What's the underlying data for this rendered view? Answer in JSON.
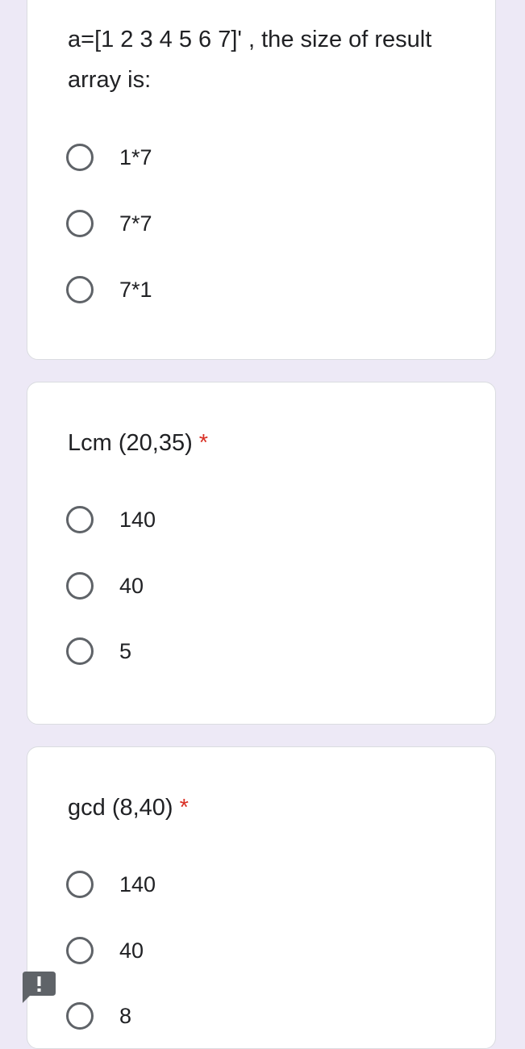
{
  "questions": [
    {
      "title": "a=[1 2 3 4 5 6 7]' , the size of result array is:",
      "required_mark": "",
      "options": [
        "1*7",
        "7*7",
        "7*1"
      ]
    },
    {
      "title": "Lcm (20,35)",
      "required_mark": "*",
      "options": [
        "140",
        "40",
        "5"
      ]
    },
    {
      "title": "gcd (8,40)",
      "required_mark": "*",
      "options": [
        "140",
        "40",
        "8"
      ]
    }
  ],
  "feedback_button": {
    "icon": "exclamation-feedback-icon"
  },
  "colors": {
    "page_background": "#ede9f6",
    "card_background": "#ffffff",
    "card_border": "#dadce0",
    "text": "#202124",
    "radio_outline": "#5f6368",
    "required": "#d93025",
    "feedback_icon": "#5f6368"
  }
}
